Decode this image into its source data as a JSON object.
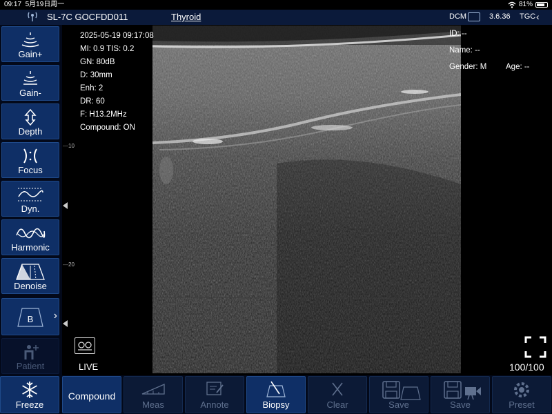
{
  "status_bar": {
    "time": "09:17",
    "date": "5月19日周一",
    "battery": "81%",
    "battery_level": 0.81
  },
  "header": {
    "probe": "SL-7C GOCFDD011",
    "preset": "Thyroid",
    "dcm": "DCM",
    "version": "3.6.36",
    "tgc": "TGC"
  },
  "left_buttons": [
    {
      "label": "Gain+",
      "icon": "gain-plus-icon"
    },
    {
      "label": "Gain-",
      "icon": "gain-minus-icon"
    },
    {
      "label": "Depth",
      "icon": "depth-icon"
    },
    {
      "label": "Focus",
      "icon": "focus-icon"
    },
    {
      "label": "Dyn.",
      "icon": "dynamic-range-icon"
    },
    {
      "label": "Harmonic",
      "icon": "harmonic-icon"
    },
    {
      "label": "Denoise",
      "icon": "denoise-icon"
    },
    {
      "label": "B",
      "icon": "b-mode-icon"
    },
    {
      "label": "Patient",
      "icon": "patient-icon"
    }
  ],
  "scan_info": {
    "datetime": "2025-05-19 09:17:08",
    "mi_tis": "MI: 0.9  TIS: 0.2",
    "gain": "GN: 80dB",
    "depth": "D: 30mm",
    "enhance": "Enh: 2",
    "dynamic_range": "DR: 60",
    "frequency": "F: H13.2MHz",
    "compound": "Compound: ON"
  },
  "patient": {
    "id": "ID: --",
    "name": "Name: --",
    "gender": "Gender: M",
    "age": "Age: --"
  },
  "ruler": {
    "mark_10": "10",
    "mark_20": "20"
  },
  "live_label": "LIVE",
  "zoom": "100/100",
  "bottom_buttons": [
    {
      "label": "Freeze",
      "icon": "snowflake-icon",
      "enabled": true
    },
    {
      "label": "Compound",
      "icon": "",
      "enabled": true
    },
    {
      "label": "Meas",
      "icon": "measure-icon",
      "enabled": false
    },
    {
      "label": "Annote",
      "icon": "annotate-icon",
      "enabled": false
    },
    {
      "label": "Biopsy",
      "icon": "biopsy-icon",
      "enabled": true
    },
    {
      "label": "Clear",
      "icon": "clear-icon",
      "enabled": false
    },
    {
      "label": "Save",
      "icon": "save-image-icon",
      "enabled": false
    },
    {
      "label": "Save",
      "icon": "save-video-icon",
      "enabled": false
    },
    {
      "label": "Preset",
      "icon": "preset-gear-icon",
      "enabled": false
    }
  ],
  "colors": {
    "header_bg": "#0b1a3a",
    "button_bg": "#0f2f66",
    "button_border": "#1f4a8a",
    "disabled_label": "#5f708e"
  }
}
